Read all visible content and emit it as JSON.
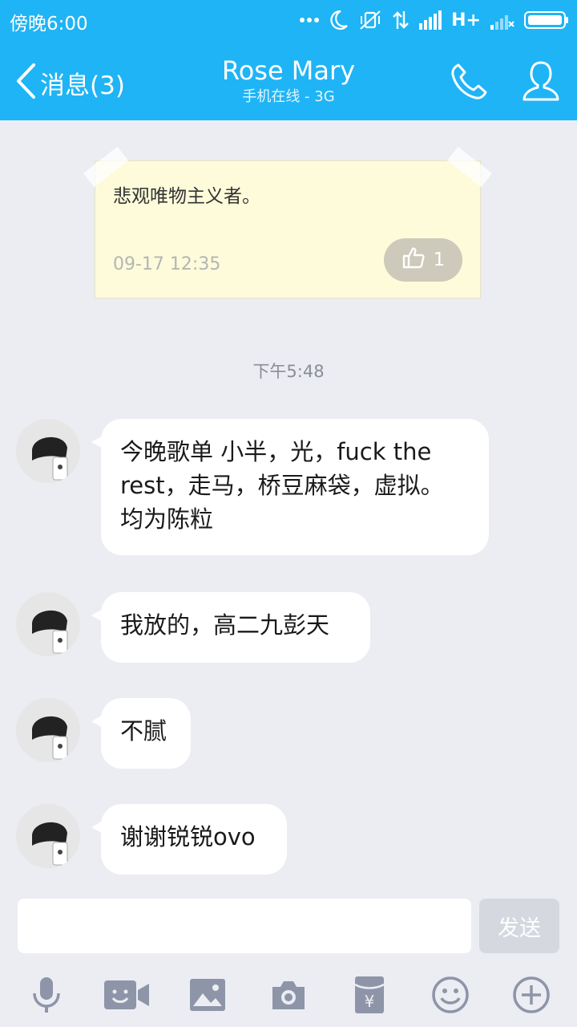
{
  "status_bar": {
    "time": "傍晚6:00",
    "network": "H+"
  },
  "header": {
    "back_label": "消息(3)",
    "contact_name": "Rose Mary",
    "contact_status": "手机在线 - 3G"
  },
  "note_card": {
    "text": "悲观唯物主义者。",
    "time": "09-17 12:35",
    "like_count": "1"
  },
  "timestamp": "下午5:48",
  "messages": [
    {
      "lines": [
        "今晚歌单 小半，光，fuck the",
        "rest，走马，桥豆麻袋，虚拟。",
        "均为陈粒"
      ]
    },
    {
      "lines": [
        "我放的，高二九彭天"
      ]
    },
    {
      "lines": [
        "不腻"
      ]
    },
    {
      "lines": [
        "谢谢锐锐ovo"
      ]
    }
  ],
  "input_bar": {
    "send_label": "发送"
  },
  "toolbar": [
    "microphone-icon",
    "video-call-icon",
    "image-icon",
    "camera-icon",
    "red-packet-icon",
    "emoji-icon",
    "plus-icon"
  ],
  "colors": {
    "header_bg": "#1fb4f5",
    "chat_bg": "#ebedf3",
    "toolbar_icon": "#8f95a8"
  }
}
